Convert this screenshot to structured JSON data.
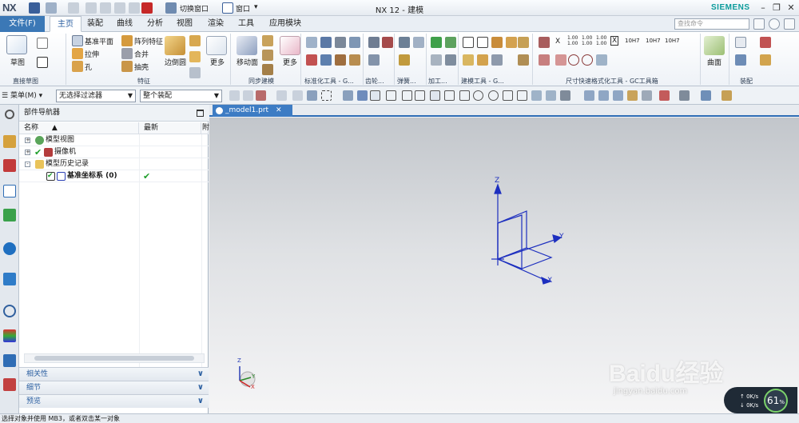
{
  "titlebar": {
    "logo": "NX",
    "switch_window": "切换窗口",
    "window_menu": "窗口",
    "title": "NX 12 - 建模"
  },
  "tabs": {
    "file": "文件(F)",
    "items": [
      "主页",
      "装配",
      "曲线",
      "分析",
      "视图",
      "渲染",
      "工具",
      "应用模块"
    ],
    "active": "主页",
    "brand": "SIEMENS",
    "search_placeholder": "查找命令"
  },
  "ribbon": {
    "sketch_label": "草图",
    "direct_sketch_group": "直接草图",
    "datum_plane": "基准平面",
    "extrude": "拉伸",
    "hole": "孔",
    "pattern_feature": "阵列特征",
    "unite": "合并",
    "shell": "抽壳",
    "edge_blend": "边倒圆",
    "more": "更多",
    "feature_group": "特征",
    "move_face": "移动面",
    "sync_group": "同步建模",
    "std_tools_group": "标准化工具 - G...",
    "gear_group": "齿轮...",
    "spring_group": "弹簧...",
    "machining_group": "加工...",
    "modeling_tools_group": "建模工具 - G...",
    "dimension_group": "尺寸快速格式化工具 - GC工具箱",
    "surface_label": "曲面",
    "assembly_group": "装配",
    "dim_text_row1": [
      "X",
      "1.00\n1.00",
      "1.00\n1.00",
      "1.00\n1.00",
      "X",
      "10H7",
      "10H7",
      "10H7"
    ],
    "dim_text_row2_label": "10H7"
  },
  "selbar": {
    "menu": "菜单(M)",
    "filter": "无选择过滤器",
    "scope": "整个装配"
  },
  "navigator": {
    "title": "部件导航器",
    "columns": [
      "名称",
      "最新",
      "附"
    ],
    "rows": [
      {
        "label": "模型视图",
        "expand": "+",
        "latest": ""
      },
      {
        "label": "摄像机",
        "expand": "+",
        "latest": ""
      },
      {
        "label": "模型历史记录",
        "expand": "-",
        "latest": ""
      },
      {
        "label": "基准坐标系 (0)",
        "expand": "",
        "latest": "✔"
      }
    ],
    "panels": [
      "相关性",
      "细节",
      "预览"
    ]
  },
  "graphics": {
    "tab": "_model1.prt",
    "axis_x": "X",
    "axis_y": "Y",
    "axis_z": "Z",
    "mini_x": "X",
    "mini_y": "Y",
    "mini_z": "Z"
  },
  "status": {
    "message": "选择对象并使用 MB3，或者双击某一对象"
  },
  "overlay": {
    "watermark": "Baidu经验",
    "watermark_url": "jingyan.baidu.com",
    "perf_value": "61",
    "perf_unit": "%",
    "net_up": "0K/s",
    "net_down": "0K/s"
  },
  "colors": {
    "accent": "#3b78b6",
    "csys": "#1d2fbf",
    "check": "#1e9e2a"
  }
}
